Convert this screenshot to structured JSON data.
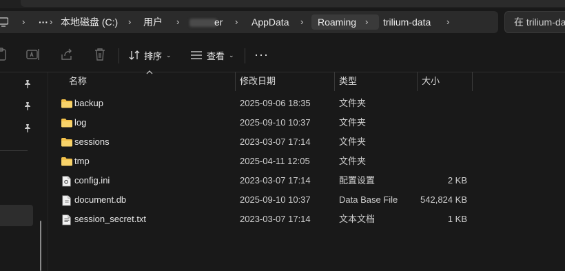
{
  "address_bar": {
    "segments": [
      "本地磁盘 (C:)",
      "用户",
      "er",
      "AppData",
      "Roaming",
      "trilium-data"
    ],
    "more_label": "···",
    "chevron": "›"
  },
  "search": {
    "placeholder": "在 trilium-data"
  },
  "toolbar": {
    "sort_label": "排序",
    "view_label": "查看",
    "more_label": "···",
    "caret": "⌄",
    "icons": [
      "paste-icon",
      "rename-icon",
      "share-icon",
      "delete-icon",
      "sort-icon",
      "view-icon"
    ]
  },
  "columns": {
    "name": "名称",
    "date": "修改日期",
    "type": "类型",
    "size": "大小"
  },
  "files": [
    {
      "name": "backup",
      "date": "2025-09-06 18:35",
      "type": "文件夹",
      "size": "",
      "icon": "folder-icon"
    },
    {
      "name": "log",
      "date": "2025-09-10 10:37",
      "type": "文件夹",
      "size": "",
      "icon": "folder-icon"
    },
    {
      "name": "sessions",
      "date": "2023-03-07 17:14",
      "type": "文件夹",
      "size": "",
      "icon": "folder-icon"
    },
    {
      "name": "tmp",
      "date": "2025-04-11 12:05",
      "type": "文件夹",
      "size": "",
      "icon": "folder-icon"
    },
    {
      "name": "config.ini",
      "date": "2023-03-07 17:14",
      "type": "配置设置",
      "size": "2 KB",
      "icon": "settings-file-icon"
    },
    {
      "name": "document.db",
      "date": "2025-09-10 10:37",
      "type": "Data Base File",
      "size": "542,824 KB",
      "icon": "file-icon"
    },
    {
      "name": "session_secret.txt",
      "date": "2023-03-07 17:14",
      "type": "文本文档",
      "size": "1 KB",
      "icon": "text-file-icon"
    }
  ],
  "colors": {
    "folder": "#f4c24b",
    "background": "#191919",
    "addressbar": "#2b2b2b"
  }
}
